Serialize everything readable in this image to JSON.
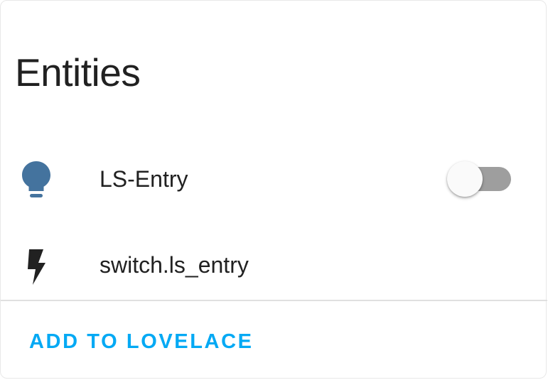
{
  "card": {
    "title": "Entities"
  },
  "entities": [
    {
      "name": "LS-Entry",
      "icon": "lightbulb-icon",
      "icon_color": "#44739e",
      "state": "off"
    },
    {
      "name": "switch.ls_entry",
      "icon": "flash-icon",
      "icon_color": "#212121"
    }
  ],
  "actions": {
    "add_label": "ADD TO LOVELACE"
  },
  "colors": {
    "accent": "#03a9f4",
    "toggle_track_off": "#9e9e9e",
    "toggle_thumb_off": "#fafafa"
  }
}
